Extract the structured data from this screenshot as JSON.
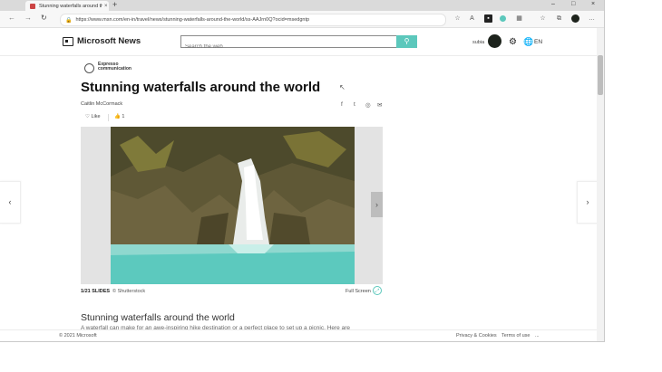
{
  "browser": {
    "tab_title": "Stunning waterfalls around the w...",
    "url": "https://www.msn.com/en-in/travel/news/stunning-waterfalls-around-the-world/ss-AAJrn0Q?ocid=msedgntp",
    "window_controls": [
      "minimize-icon",
      "maximize-icon",
      "close-icon"
    ]
  },
  "msn": {
    "brand": "Microsoft News",
    "search_placeholder": "Search the web",
    "user_name": "subia",
    "language": "EN",
    "accent_color": "#5cc8bc"
  },
  "article": {
    "publisher": "Expresso communication",
    "headline": "Stunning waterfalls around the world",
    "author": "Caitlin McCormack",
    "like_label": "Like",
    "reaction_count": "1",
    "slide_counter": "1/21 SLIDES",
    "photo_credit": "© Shutterstock",
    "full_screen_label": "Full Screen",
    "subheading": "Stunning waterfalls around the world",
    "body_preview": "A waterfall can make for an awe-inspiring hike destination or a perfect place to set up a picnic. Here are"
  },
  "footer": {
    "copyright": "© 2021 Microsoft",
    "privacy": "Privacy & Cookies",
    "terms": "Terms of use",
    "more": "..."
  }
}
